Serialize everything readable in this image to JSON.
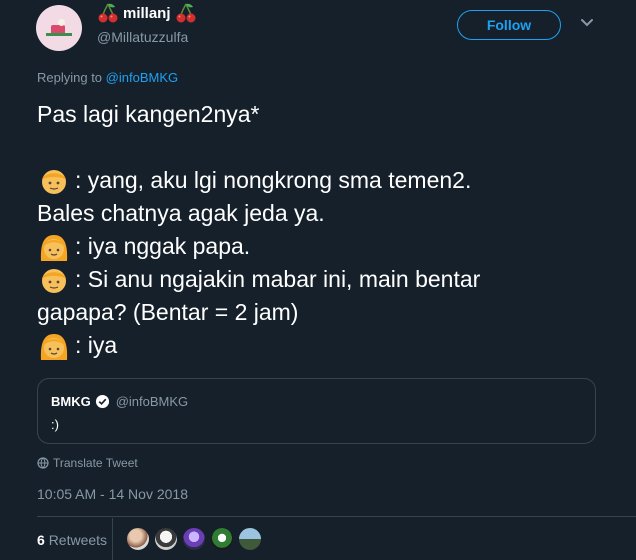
{
  "user": {
    "display_name": "millanj",
    "handle": "@Millatuzzulfa",
    "avatar_icon": "profile-avatar",
    "name_icons": [
      "cherry-icon",
      "cherry-icon"
    ]
  },
  "follow_button": {
    "label": "Follow"
  },
  "reply": {
    "prefix": "Replying to",
    "mention": "@infoBMKG"
  },
  "tweet": {
    "lines": [
      {
        "emoji": null,
        "text": "Pas lagi kangen2nya*"
      },
      {
        "emoji": null,
        "text": ""
      },
      {
        "emoji": "boy-emoji",
        "text": ": yang, aku lgi nongkrong sma temen2."
      },
      {
        "emoji": null,
        "text": "Bales chatnya agak jeda ya."
      },
      {
        "emoji": "girl-emoji",
        "text": ": iya nggak papa."
      },
      {
        "emoji": "boy-emoji",
        "text": ": Si anu ngajakin mabar ini, main bentar"
      },
      {
        "emoji": null,
        "text": "gapapa? (Bentar = 2 jam)"
      },
      {
        "emoji": "girl-emoji",
        "text": ": iya"
      }
    ]
  },
  "quoted_tweet": {
    "name": "BMKG",
    "handle": "@infoBMKG",
    "text": ":)"
  },
  "translate": {
    "label": "Translate Tweet"
  },
  "timestamp": "10:05 AM - 14 Nov 2018",
  "stats": {
    "retweets_count": "6",
    "retweets_label": "Retweets"
  },
  "retweeter_avatars": [
    "retweeter-avatar-1",
    "retweeter-avatar-2",
    "retweeter-avatar-3",
    "retweeter-avatar-4",
    "retweeter-avatar-5"
  ],
  "colors": {
    "background": "#15202b",
    "accent": "#1da1f2",
    "secondary_text": "#8899a6",
    "border": "#38444d"
  }
}
